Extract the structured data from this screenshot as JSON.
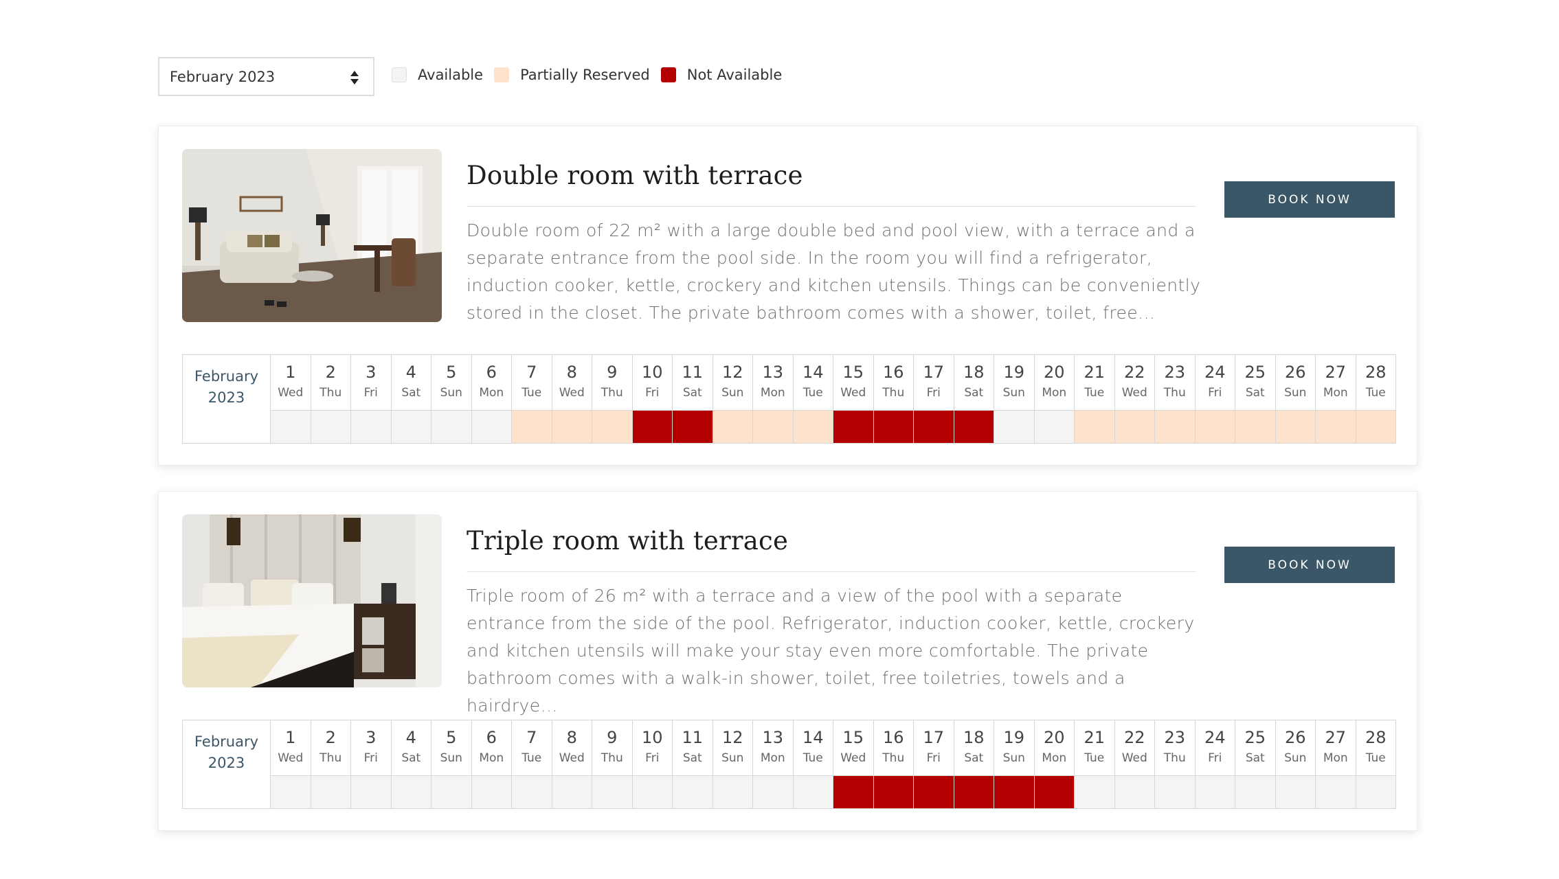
{
  "controls": {
    "month_select": {
      "value": "February 2023",
      "icon": "sort-arrows-icon"
    },
    "legend": [
      {
        "label": "Available",
        "color": "#f4f4f4",
        "status": "available"
      },
      {
        "label": "Partially Reserved",
        "color": "#fde2cc",
        "status": "partial"
      },
      {
        "label": "Not Available",
        "color": "#b20000",
        "status": "booked"
      }
    ]
  },
  "calendar": {
    "month": "February",
    "year": "2023",
    "days": [
      {
        "d": "1",
        "w": "Wed"
      },
      {
        "d": "2",
        "w": "Thu"
      },
      {
        "d": "3",
        "w": "Fri"
      },
      {
        "d": "4",
        "w": "Sat"
      },
      {
        "d": "5",
        "w": "Sun"
      },
      {
        "d": "6",
        "w": "Mon"
      },
      {
        "d": "7",
        "w": "Tue"
      },
      {
        "d": "8",
        "w": "Wed"
      },
      {
        "d": "9",
        "w": "Thu"
      },
      {
        "d": "10",
        "w": "Fri"
      },
      {
        "d": "11",
        "w": "Sat"
      },
      {
        "d": "12",
        "w": "Sun"
      },
      {
        "d": "13",
        "w": "Mon"
      },
      {
        "d": "14",
        "w": "Tue"
      },
      {
        "d": "15",
        "w": "Wed"
      },
      {
        "d": "16",
        "w": "Thu"
      },
      {
        "d": "17",
        "w": "Fri"
      },
      {
        "d": "18",
        "w": "Sat"
      },
      {
        "d": "19",
        "w": "Sun"
      },
      {
        "d": "20",
        "w": "Mon"
      },
      {
        "d": "21",
        "w": "Tue"
      },
      {
        "d": "22",
        "w": "Wed"
      },
      {
        "d": "23",
        "w": "Thu"
      },
      {
        "d": "24",
        "w": "Fri"
      },
      {
        "d": "25",
        "w": "Sat"
      },
      {
        "d": "26",
        "w": "Sun"
      },
      {
        "d": "27",
        "w": "Mon"
      },
      {
        "d": "28",
        "w": "Tue"
      }
    ]
  },
  "rooms": [
    {
      "title": "Double room with terrace",
      "description": "Double room of 22 m² with a large double bed and pool view, with a terrace and a separate entrance from the pool side. In the room you will find a refrigerator, induction cooker, kettle, crockery and kitchen utensils. Things can be conveniently stored in the closet. The private bathroom comes with a shower, toilet, free…",
      "book_label": "BOOK NOW",
      "availability": [
        "available",
        "available",
        "available",
        "available",
        "available",
        "available",
        "partial",
        "partial",
        "partial",
        "booked",
        "booked",
        "partial",
        "partial",
        "partial",
        "booked",
        "booked",
        "booked",
        "booked",
        "available",
        "available",
        "partial",
        "partial",
        "partial",
        "partial",
        "partial",
        "partial",
        "partial",
        "partial"
      ]
    },
    {
      "title": "Triple room with terrace",
      "description": "Triple room of 26 m² with a terrace and a view of the pool with a separate entrance from the side of the pool. Refrigerator, induction cooker, kettle, crockery and kitchen utensils will make your stay even more comfortable. The private bathroom comes with a walk-in shower, toilet, free toiletries, towels and a hairdrye…",
      "book_label": "BOOK NOW",
      "availability": [
        "available",
        "available",
        "available",
        "available",
        "available",
        "available",
        "available",
        "available",
        "available",
        "available",
        "available",
        "available",
        "available",
        "available",
        "booked",
        "booked",
        "booked",
        "booked",
        "booked",
        "booked",
        "available",
        "available",
        "available",
        "available",
        "available",
        "available",
        "available",
        "available"
      ]
    }
  ]
}
